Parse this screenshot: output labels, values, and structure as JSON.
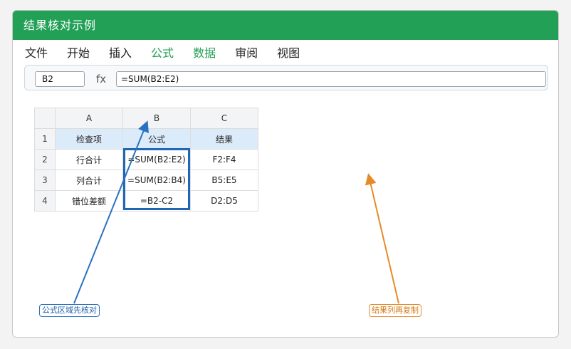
{
  "window": {
    "title": "结果核对示例"
  },
  "menu": [
    "文件",
    "开始",
    "插入",
    "公式",
    "数据",
    "审阅",
    "视图"
  ],
  "formula_bar": {
    "cell_ref": "B2",
    "fx_label": "fx",
    "formula": "=SUM(B2:E2)"
  },
  "sheet": {
    "columns": [
      "A",
      "B",
      "C"
    ],
    "rows": [
      {
        "num": "1",
        "cells": [
          "检查项",
          "公式",
          "结果"
        ]
      },
      {
        "num": "2",
        "cells": [
          "行合计",
          "=SUM(B2:E2)",
          "F2:F4"
        ]
      },
      {
        "num": "3",
        "cells": [
          "列合计",
          "=SUM(B2:B4)",
          "B5:E5"
        ]
      },
      {
        "num": "4",
        "cells": [
          "错位差额",
          "=B2-C2",
          "D2:D5"
        ]
      }
    ]
  },
  "annotations": {
    "left_label": "公式区域先核对",
    "right_label": "结果列再复制"
  },
  "colors": {
    "title_green": "#21a056",
    "highlight_blue": "#1f66b5",
    "arrow_orange": "#e58b2a",
    "header_blue": "#dcebfa"
  }
}
